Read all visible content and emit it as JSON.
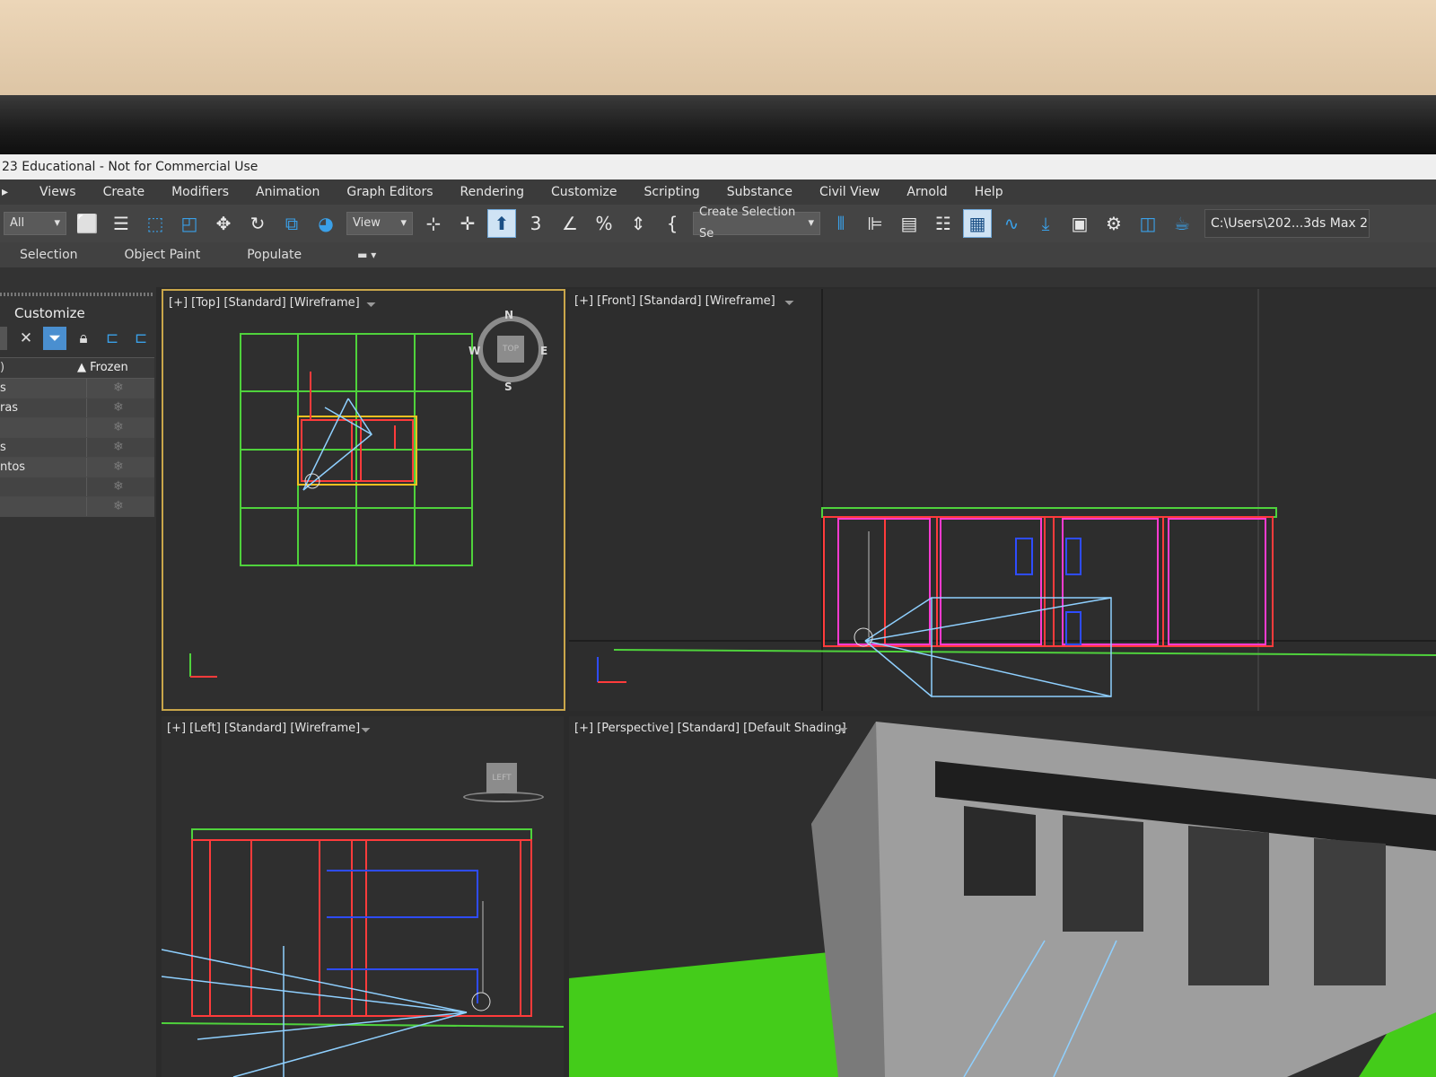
{
  "window": {
    "title": "23 Educational - Not for Commercial Use"
  },
  "menu": [
    "Views",
    "Create",
    "Modifiers",
    "Animation",
    "Graph Editors",
    "Rendering",
    "Customize",
    "Scripting",
    "Substance",
    "Civil View",
    "Arnold",
    "Help"
  ],
  "toolbar": {
    "filter_value": "All",
    "ref_coord_value": "View",
    "named_selection_value": "Create Selection Se",
    "path_value": "C:\\Users\\202...3ds Max 20"
  },
  "ribbon": {
    "tabs": [
      "Selection",
      "Object Paint",
      "Populate"
    ]
  },
  "explorer": {
    "title": "Customize",
    "column_header": "Frozen",
    "rows": [
      "s",
      "ras",
      "",
      "s",
      "ntos",
      "",
      ""
    ]
  },
  "viewports": {
    "top": {
      "label": "[+] [Top] [Standard] [Wireframe]",
      "viewcube": "TOP",
      "compass": {
        "n": "N",
        "s": "S",
        "e": "E",
        "w": "W"
      }
    },
    "front": {
      "label": "[+] [Front] [Standard] [Wireframe]"
    },
    "left": {
      "label": "[+] [Left] [Standard] [Wireframe]",
      "viewcube": "LEFT"
    },
    "perspective": {
      "label": "[+] [Perspective] [Standard] [Default Shading]"
    }
  },
  "colors": {
    "grid": "#4fd23c",
    "wall": "#ff3b3b",
    "magenta": "#ff3bd0",
    "blue": "#2e4cff",
    "camera": "#8fd0ff",
    "selection": "#c9a64a"
  },
  "icons": [
    "select-object-icon",
    "select-by-name-icon",
    "rect-selection-icon",
    "window-crossing-icon",
    "move-icon",
    "rotate-icon",
    "scale-icon",
    "select-place-icon",
    "pivot-icon",
    "snap-toggle-icon",
    "angle-snap-icon",
    "percent-snap-icon",
    "spinner-snap-icon",
    "edit-named-sets-icon",
    "mirror-icon",
    "align-icon",
    "scene-explorer-icon",
    "layer-explorer-icon",
    "ribbon-icon",
    "curve-editor-icon",
    "schematic-icon",
    "material-editor-icon",
    "render-setup-icon",
    "rendered-frame-icon",
    "render-icon"
  ]
}
